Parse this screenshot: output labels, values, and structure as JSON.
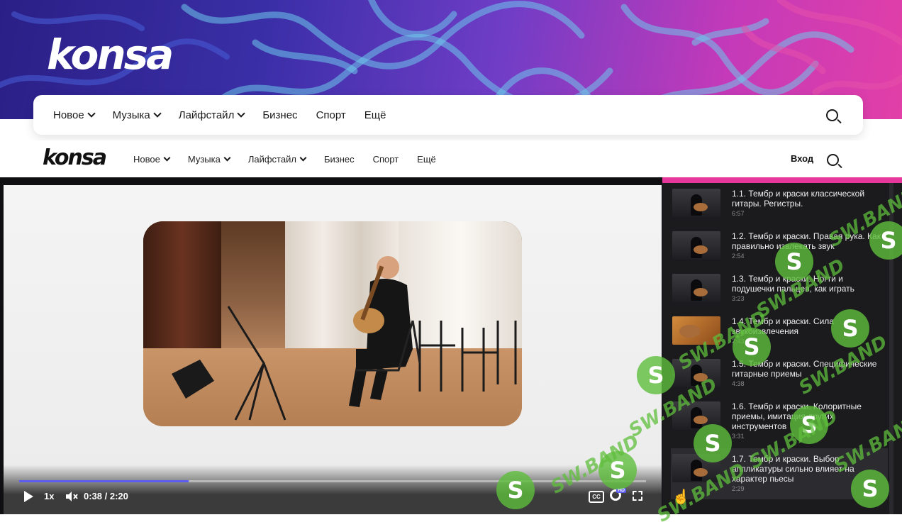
{
  "brand": {
    "logo_text": "konsa"
  },
  "main_nav": {
    "items": [
      {
        "label": "Новое",
        "has_dropdown": true
      },
      {
        "label": "Музыка",
        "has_dropdown": true
      },
      {
        "label": "Лайфстайл",
        "has_dropdown": true
      },
      {
        "label": "Бизнес",
        "has_dropdown": false
      },
      {
        "label": "Спорт",
        "has_dropdown": false
      },
      {
        "label": "Ещё",
        "has_dropdown": false
      }
    ]
  },
  "sticky_header": {
    "login_label": "Вход"
  },
  "player": {
    "speed_label": "1x",
    "time_current": "0:38",
    "time_total": "2:20",
    "time_display": "0:38 / 2:20",
    "progress_fraction": 0.27,
    "hd_badge": "HD",
    "cc_label": "CC",
    "accent_color": "#5b5cf0"
  },
  "playlist": {
    "accent_color": "#e8379c",
    "items": [
      {
        "title": "1.1. Тембр и краски классической гитары. Регистры.",
        "duration": "6:57"
      },
      {
        "title": "1.2. Тембр и краски. Правая рука. Как правильно извлекать звук",
        "duration": "2:54"
      },
      {
        "title": "1.3. Тембр и краски. Ногти и подушечки пальцев, как играть",
        "duration": "3:23"
      },
      {
        "title": "1.4. Тембр и краски. Сила звукоизвлечения",
        "duration": "2:43"
      },
      {
        "title": "1.5. Тембр и краски. Специфические гитарные приемы",
        "duration": "4:38"
      },
      {
        "title": "1.6. Тембр и краски. Колоритные приемы, имитация других инструментов",
        "duration": "3:31"
      },
      {
        "title": "1.7. Тембр и краски. Выбор аппликатуры сильно влияет на характер пьесы",
        "duration": "2:29"
      }
    ]
  },
  "watermark": {
    "text": "SW.BAND"
  }
}
